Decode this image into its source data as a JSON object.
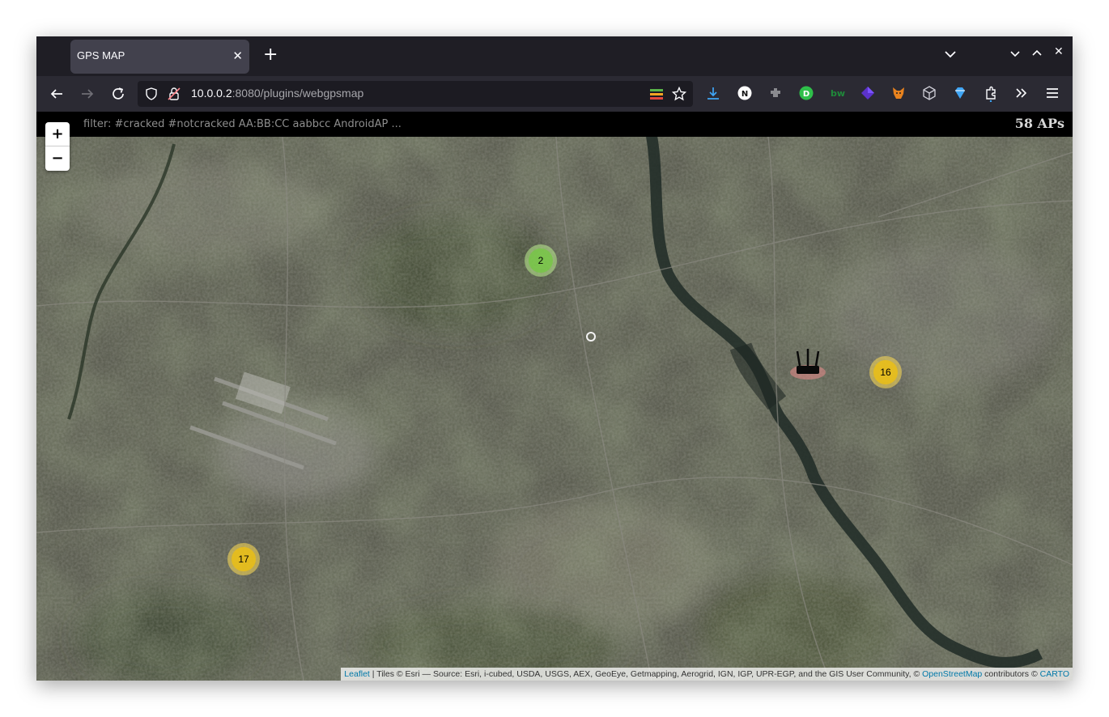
{
  "browser": {
    "tab_title": "GPS MAP",
    "url_host": "10.0.0.2",
    "url_rest": ":8080/plugins/webgpsmap"
  },
  "colors": {
    "cluster_small_outer": "#b5e28c",
    "cluster_small_inner": "#6ecc39",
    "cluster_medium_outer": "#f1d357",
    "cluster_medium_inner": "#f0c20c",
    "router_halo": "#e88a8a"
  },
  "filter": {
    "placeholder": "filter: #cracked #notcracked AA:BB:CC aabbcc AndroidAP ...",
    "ap_count": "58 APs"
  },
  "zoom": {
    "in_label": "+",
    "out_label": "−"
  },
  "clusters": [
    {
      "count": "2",
      "size": "small"
    },
    {
      "count": "16",
      "size": "medium"
    },
    {
      "count": "17",
      "size": "medium"
    }
  ],
  "attribution": {
    "leaflet": "Leaflet",
    "sep": " | ",
    "tiles": "Tiles © Esri — Source: Esri, i-cubed, USDA, USGS, AEX, GeoEye, Getmapping, Aerogrid, IGN, IGP, UPR-EGP, and the GIS User Community, © ",
    "osm": "OpenStreetMap",
    "contrib": " contributors © ",
    "carto": "CARTO"
  }
}
